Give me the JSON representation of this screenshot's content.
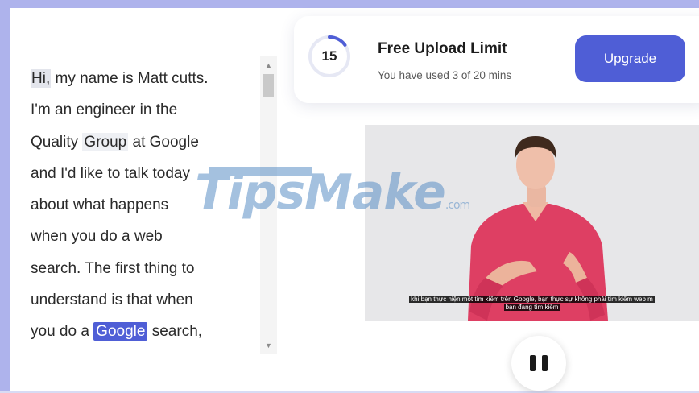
{
  "transcript": {
    "lines": [
      [
        "Hi,",
        " my name is Matt cutts."
      ],
      [
        "I'm an engineer in the"
      ],
      [
        "Quality ",
        "Group",
        " at Google"
      ],
      [
        "and I'd like to talk today"
      ],
      [
        "about what happens"
      ],
      [
        "when you do a web"
      ],
      [
        "search. The first thing to"
      ],
      [
        "understand is that when"
      ],
      [
        "you do a ",
        "Google",
        " search,"
      ]
    ]
  },
  "upload_limit": {
    "minutes_left": "15",
    "used_fraction": 0.15,
    "title": "Free Upload Limit",
    "subtitle": "You have used 3 of 20 mins",
    "upgrade_label": "Upgrade"
  },
  "video": {
    "subtitle_line1": "khi bạn thực hiện một tìm kiếm trên Google, bạn thực sự không phải tìm kiếm web m",
    "subtitle_line2": "bạn đang tìm kiếm"
  },
  "watermark": {
    "text_tips": "Tips",
    "text_make": "Make",
    "text_com": ".com"
  },
  "colors": {
    "accent": "#4f5ed6",
    "frame": "#aeb3ec",
    "ring_track": "#e6e8f4"
  },
  "player": {
    "state_icon": "pause-icon"
  }
}
